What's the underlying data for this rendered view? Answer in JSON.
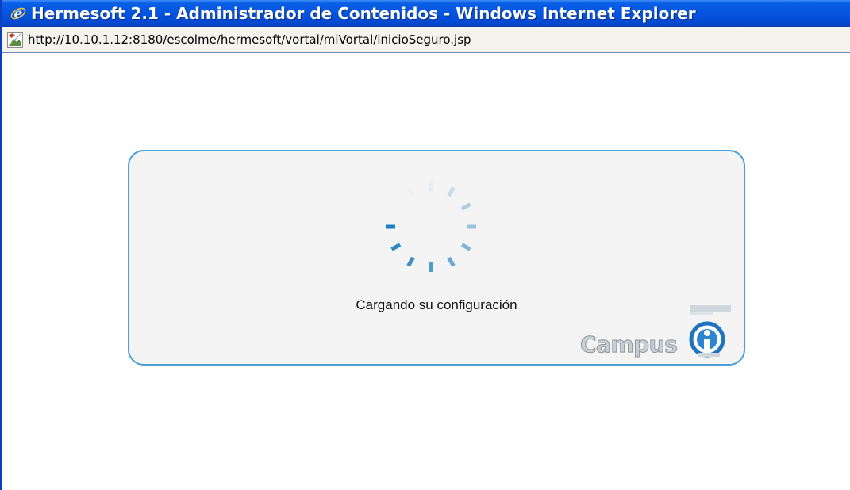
{
  "window": {
    "title": "Hermesoft 2.1 - Administrador de Contenidos - Windows Internet Explorer",
    "icon": "ie-icon"
  },
  "addressbar": {
    "url": "http://10.10.1.12:8180/escolme/hermesoft/vortal/miVortal/inicioSeguro.jsp",
    "icon": "broken-image-icon"
  },
  "main": {
    "loading_text": "Cargando su configuración",
    "spinner_icon": "spinner-icon",
    "logo": {
      "text": "Campus",
      "icon": "campus-logo-icon"
    }
  },
  "colors": {
    "titlebar": "#0454e0",
    "panel_border": "#4a9fd8",
    "spinner": "#1a87c9"
  }
}
